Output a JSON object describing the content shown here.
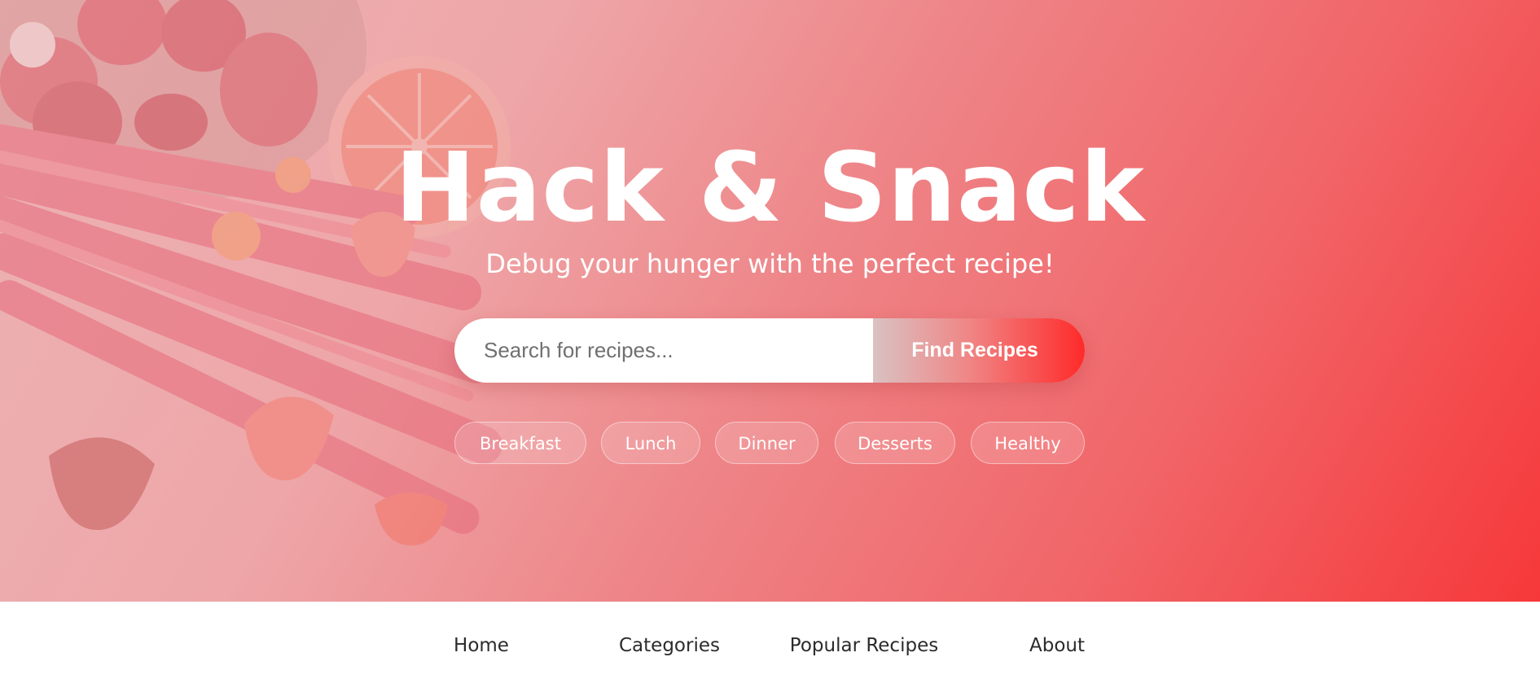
{
  "hero": {
    "title": "Hack & Snack",
    "subtitle": "Debug your hunger with the perfect recipe!",
    "gradient_colors": [
      "#ecb3b5",
      "#ee8487",
      "#f6383a"
    ]
  },
  "search": {
    "placeholder": "Search for recipes...",
    "value": "",
    "button_label": "Find Recipes"
  },
  "tags": [
    {
      "label": "Breakfast"
    },
    {
      "label": "Lunch"
    },
    {
      "label": "Dinner"
    },
    {
      "label": "Desserts"
    },
    {
      "label": "Healthy"
    }
  ],
  "nav": {
    "items": [
      {
        "label": "Home"
      },
      {
        "label": "Categories"
      },
      {
        "label": "Popular Recipes"
      },
      {
        "label": "About"
      }
    ]
  },
  "colors": {
    "accent": "#f6383a",
    "text_dark": "#2b2b2b",
    "white": "#ffffff"
  }
}
